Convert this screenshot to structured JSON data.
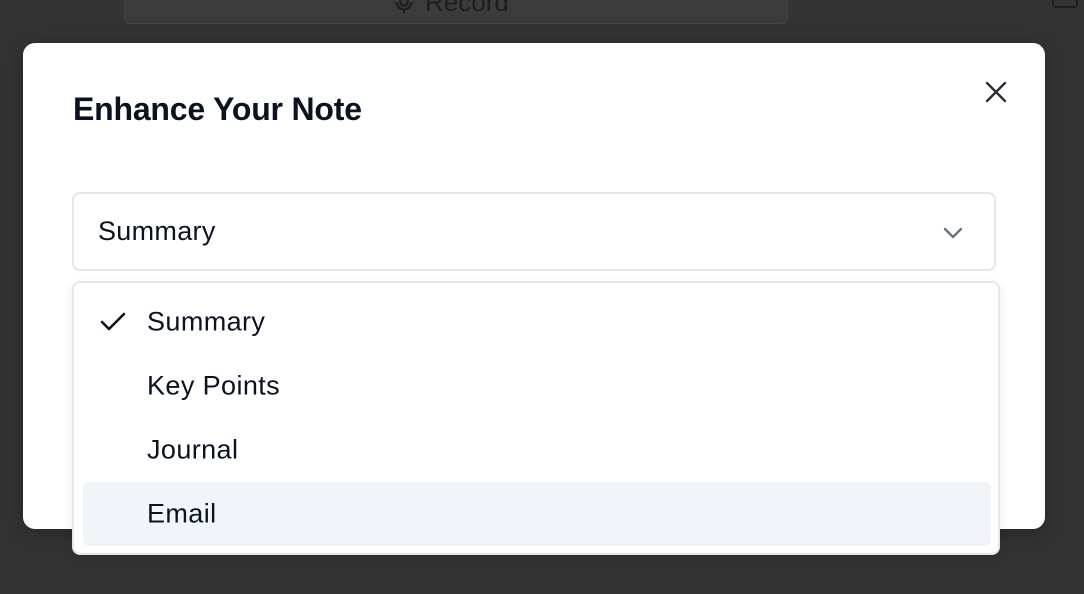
{
  "background": {
    "record_label": "Record"
  },
  "modal": {
    "title": "Enhance Your Note",
    "close_icon": "close-icon",
    "select": {
      "selected": "Summary",
      "chevron_icon": "chevron-down-icon"
    },
    "menu": {
      "items": [
        {
          "label": "Summary",
          "checked": true,
          "highlighted": false
        },
        {
          "label": "Key Points",
          "checked": false,
          "highlighted": false
        },
        {
          "label": "Journal",
          "checked": false,
          "highlighted": false
        },
        {
          "label": "Email",
          "checked": false,
          "highlighted": true
        }
      ],
      "check_icon": "check-icon"
    }
  },
  "colors": {
    "overlay": "#333333",
    "text": "#0b1220",
    "border": "#e3e6ea",
    "highlight": "#f1f4f9"
  }
}
